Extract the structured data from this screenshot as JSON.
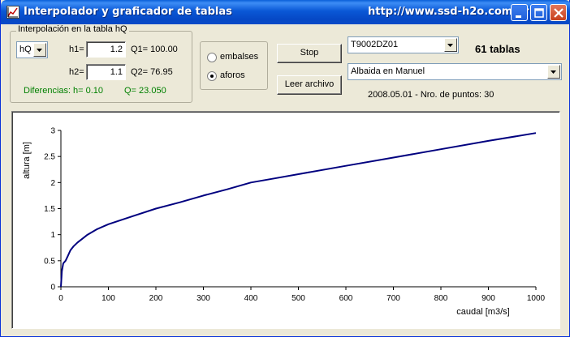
{
  "window": {
    "title": "Interpolador y graficador de tablas",
    "url": "http://www.ssd-h2o.com.ar",
    "accent": "#0a58d6"
  },
  "interpolation": {
    "group_label": "Interpolación en la tabla hQ",
    "mode_combo_value": "hQ",
    "h1_label": "h1=",
    "h1_value": "1.2",
    "q1_text": "Q1= 100.00",
    "h2_label": "h2=",
    "h2_value": "1.1",
    "q2_text": "Q2= 76.95",
    "diff_label": "Diferencias:",
    "diff_h": "h=  0.10",
    "diff_q": "Q= 23.050"
  },
  "source": {
    "options": [
      "embalses",
      "aforos"
    ],
    "selected": "aforos"
  },
  "buttons": {
    "stop_label": "Stop",
    "read_file_label": "Leer archivo"
  },
  "table": {
    "code_value": "T9002DZ01",
    "count_text": "61 tablas",
    "station_value": "Albaida en Manuel",
    "info_text": "2008.05.01 - Nro. de puntos: 30"
  },
  "chart_data": {
    "type": "line",
    "xlabel": "caudal [m3/s]",
    "ylabel": "altura [m]",
    "xlim": [
      0,
      1000
    ],
    "ylim": [
      0,
      3
    ],
    "x_ticks": [
      0,
      100,
      200,
      300,
      400,
      500,
      600,
      700,
      800,
      900,
      1000
    ],
    "y_ticks": [
      0,
      0.5,
      1,
      1.5,
      2,
      2.5,
      3
    ],
    "grid": false,
    "line_color": "#00007f",
    "series": [
      {
        "x": [
          0,
          2,
          5,
          10,
          15,
          20,
          27,
          35,
          45,
          56,
          75,
          100,
          150,
          200,
          250,
          300,
          350,
          400,
          450,
          500,
          600,
          700,
          800,
          900,
          1000
        ],
        "y": [
          0,
          0.3,
          0.45,
          0.5,
          0.6,
          0.7,
          0.78,
          0.85,
          0.92,
          1.0,
          1.1,
          1.2,
          1.35,
          1.5,
          1.62,
          1.75,
          1.87,
          2.0,
          2.08,
          2.16,
          2.32,
          2.48,
          2.64,
          2.8,
          2.95
        ]
      }
    ]
  }
}
